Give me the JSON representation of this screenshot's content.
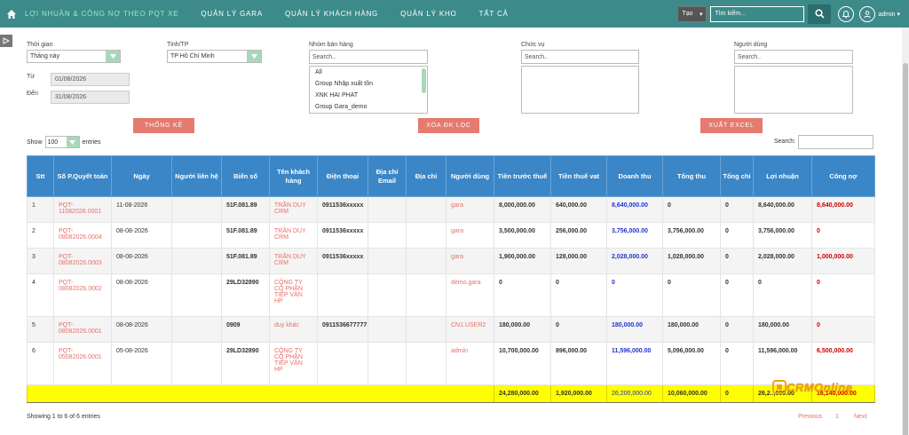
{
  "nav": {
    "items": [
      "Lợi nhuận & công nợ theo PQT xe",
      "Quản lý Gara",
      "Quản lý khách hàng",
      "Quản lý kho",
      "Tất cả"
    ],
    "tao_label": "Tạo",
    "search_placeholder": "Tìm kiếm...",
    "user_label": "admin"
  },
  "filters": {
    "thoi_gian_label": "Thời gian",
    "thoi_gian_value": "Tháng này",
    "tinh_label": "Tỉnh/TP",
    "tinh_value": "TP Hồ Chí Minh",
    "tu_label": "Từ",
    "tu_value": "01/08/2026",
    "den_label": "Đến",
    "den_value": "31/08/2026",
    "nhom_label": "Nhóm bán hàng",
    "nhom_placeholder": "Search..",
    "nhom_options": [
      "All",
      "Group Nhập xuất tồn",
      "XNK HAI PHAT",
      "Group Gara_demo"
    ],
    "chuc_vu_label": "Chức vụ",
    "chuc_vu_placeholder": "Search..",
    "nguoi_dung_label": "Người dùng",
    "nguoi_dung_placeholder": "Search..",
    "btn_thong_ke": "THỐNG KÊ",
    "btn_xoa": "XÓA ĐK LỌC",
    "btn_excel": "XUẤT EXCEL"
  },
  "table_controls": {
    "show_label": "Show",
    "show_value": "100",
    "entries_label": "entries",
    "search_label": "Search:"
  },
  "table": {
    "headers": [
      "Stt",
      "Số P.Quyết toán",
      "Ngày",
      "Người liên hệ",
      "Biển số",
      "Tên khách hàng",
      "Điện thoại",
      "Địa chỉ Email",
      "Địa chỉ",
      "Người dùng",
      "Tiền trước thuế",
      "Tiền thuế vat",
      "Doanh thu",
      "Tổng thu",
      "Tổng chi",
      "Lợi nhuận",
      "Công nợ"
    ],
    "rows": [
      {
        "stt": "1",
        "so": "PQT-11082026.0001",
        "ngay": "11-08-2026",
        "lien_he": "",
        "bien_so": "51F.081.89",
        "khach": "TRẦN DUY CRM",
        "dt": "0911536xxxxx",
        "email": "",
        "dia_chi": "",
        "user": "gara",
        "truoc_thue": "8,000,000.00",
        "vat": "640,000.00",
        "doanh_thu": "8,640,000.00",
        "tong_thu": "0",
        "tong_chi": "0",
        "loi_nhuan": "8,640,000.00",
        "cong_no": "8,640,000.00"
      },
      {
        "stt": "2",
        "so": "PQT-08082026.0004",
        "ngay": "08-08-2026",
        "lien_he": "",
        "bien_so": "51F.081.89",
        "khach": "TRẦN DUY CRM",
        "dt": "0911536xxxxx",
        "email": "",
        "dia_chi": "",
        "user": "gara",
        "truoc_thue": "3,500,000.00",
        "vat": "256,000.00",
        "doanh_thu": "3,756,000.00",
        "tong_thu": "3,756,000.00",
        "tong_chi": "0",
        "loi_nhuan": "3,756,000.00",
        "cong_no": "0"
      },
      {
        "stt": "3",
        "so": "PQT-08082026.0003",
        "ngay": "08-08-2026",
        "lien_he": "",
        "bien_so": "51F.081.89",
        "khach": "TRẦN DUY CRM",
        "dt": "0911536xxxxx",
        "email": "",
        "dia_chi": "",
        "user": "gara",
        "truoc_thue": "1,900,000.00",
        "vat": "128,000.00",
        "doanh_thu": "2,028,000.00",
        "tong_thu": "1,028,000.00",
        "tong_chi": "0",
        "loi_nhuan": "2,028,000.00",
        "cong_no": "1,000,000.00"
      },
      {
        "stt": "4",
        "so": "PQT-08082026.0002",
        "ngay": "08-08-2026",
        "lien_he": "",
        "bien_so": "29LD32890",
        "khach": "CÔNG TY CỔ PHẦN TIẾP VẬN HP",
        "dt": "",
        "email": "",
        "dia_chi": "",
        "user": "demo.gara",
        "truoc_thue": "0",
        "vat": "0",
        "doanh_thu": "0",
        "tong_thu": "0",
        "tong_chi": "0",
        "loi_nhuan": "0",
        "cong_no": "0"
      },
      {
        "stt": "5",
        "so": "PQT-08082026.0001",
        "ngay": "08-08-2026",
        "lien_he": "",
        "bien_so": "0909",
        "khach": "duy khác",
        "dt": "0911536677777",
        "email": "",
        "dia_chi": "",
        "user": "CN1.USER2",
        "truoc_thue": "180,000.00",
        "vat": "0",
        "doanh_thu": "180,000.00",
        "tong_thu": "180,000.00",
        "tong_chi": "0",
        "loi_nhuan": "180,000.00",
        "cong_no": "0"
      },
      {
        "stt": "6",
        "so": "PQT-05082026.0001",
        "ngay": "05-08-2026",
        "lien_he": "",
        "bien_so": "29LD32890",
        "khach": "CÔNG TY CỔ PHẦN TIẾP VẬN HP",
        "dt": "",
        "email": "",
        "dia_chi": "",
        "user": "admin",
        "truoc_thue": "10,700,000.00",
        "vat": "896,000.00",
        "doanh_thu": "11,596,000.00",
        "tong_thu": "5,096,000.00",
        "tong_chi": "0",
        "loi_nhuan": "11,596,000.00",
        "cong_no": "6,500,000.00"
      }
    ],
    "totals": {
      "truoc_thue": "24,280,000.00",
      "vat": "1,920,000.00",
      "doanh_thu": "26,200,000.00",
      "tong_thu": "10,060,000.00",
      "tong_chi": "0",
      "loi_nhuan": "26,2..,000.00",
      "cong_no": "16,140,000.00"
    }
  },
  "footer": {
    "showing": "Showing 1 to 6 of 6 entries",
    "prev": "Previous",
    "page": "1",
    "next": "Next",
    "logo": "CRMOnline"
  },
  "colors": {
    "nav_bg": "#3d8a8a",
    "header_bg": "#3b86c6",
    "button": "#e57a6e",
    "total_row": "#ffff00"
  }
}
